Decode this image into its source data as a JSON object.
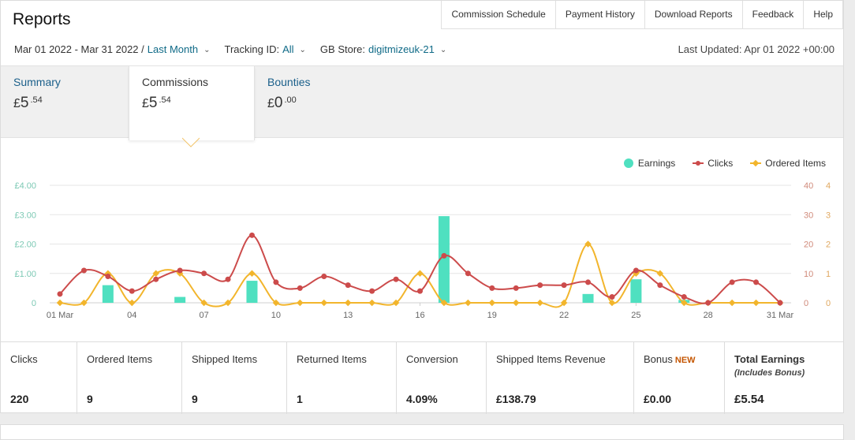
{
  "header": {
    "title": "Reports",
    "nav": [
      "Commission Schedule",
      "Payment History",
      "Download Reports",
      "Feedback",
      "Help"
    ]
  },
  "filters": {
    "date_range": "Mar 01 2022 - Mar 31 2022 /",
    "period": "Last Month",
    "tracking_label": "Tracking ID:",
    "tracking_value": "All",
    "store_label": "GB Store:",
    "store_value": "digitmizeuk-21",
    "last_updated": "Last Updated: Apr 01 2022 +00:00"
  },
  "tabs": [
    {
      "label": "Summary",
      "currency": "£",
      "whole": "5",
      "fraction": ".54"
    },
    {
      "label": "Commissions",
      "currency": "£",
      "whole": "5",
      "fraction": ".54"
    },
    {
      "label": "Bounties",
      "currency": "£",
      "whole": "0",
      "fraction": ".00"
    }
  ],
  "legend": {
    "earnings": "Earnings",
    "clicks": "Clicks",
    "ordered": "Ordered Items"
  },
  "colors": {
    "earnings": "#4fe0c0",
    "clicks": "#cc4b4b",
    "ordered": "#f2b52c",
    "link": "#0f6a87",
    "new_badge": "#c45500"
  },
  "chart_data": {
    "type": "line",
    "x": [
      1,
      2,
      3,
      4,
      5,
      6,
      7,
      8,
      9,
      10,
      11,
      12,
      13,
      14,
      15,
      16,
      17,
      18,
      19,
      20,
      21,
      22,
      23,
      24,
      25,
      26,
      27,
      28,
      29,
      30,
      31
    ],
    "xticks": [
      {
        "day": 1,
        "label": "01 Mar"
      },
      {
        "day": 4,
        "label": "04"
      },
      {
        "day": 7,
        "label": "07"
      },
      {
        "day": 10,
        "label": "10"
      },
      {
        "day": 13,
        "label": "13"
      },
      {
        "day": 16,
        "label": "16"
      },
      {
        "day": 19,
        "label": "19"
      },
      {
        "day": 22,
        "label": "22"
      },
      {
        "day": 25,
        "label": "25"
      },
      {
        "day": 28,
        "label": "28"
      },
      {
        "day": 31,
        "label": "31 Mar"
      }
    ],
    "yleft": {
      "ticks": [
        "0",
        "£1.00",
        "£2.00",
        "£3.00",
        "£4.00"
      ],
      "ylim": [
        0,
        4
      ]
    },
    "yright_clicks": {
      "ticks": [
        "0",
        "10",
        "20",
        "30",
        "40"
      ],
      "ylim": [
        0,
        40
      ]
    },
    "yright_ordered": {
      "ticks": [
        "0",
        "1",
        "2",
        "3",
        "4"
      ],
      "ylim": [
        0,
        4
      ]
    },
    "series": [
      {
        "name": "Earnings",
        "type": "bar",
        "axis": "left",
        "values": [
          0,
          0,
          0.6,
          0,
          0,
          0.2,
          0,
          0,
          0.75,
          0,
          0,
          0,
          0,
          0,
          0,
          0,
          2.95,
          0,
          0,
          0,
          0,
          0,
          0.3,
          0,
          0.8,
          0,
          0.1,
          0,
          0,
          0,
          0
        ]
      },
      {
        "name": "Clicks",
        "type": "line",
        "axis": "clicks",
        "values": [
          3,
          11,
          9,
          4,
          8,
          11,
          10,
          8,
          23,
          7,
          5,
          9,
          6,
          4,
          8,
          4,
          16,
          10,
          5,
          5,
          6,
          6,
          7,
          2,
          11,
          6,
          2,
          0,
          7,
          7,
          0
        ]
      },
      {
        "name": "Ordered Items",
        "type": "line",
        "axis": "ordered",
        "values": [
          0,
          0,
          1,
          0,
          1,
          1,
          0,
          0,
          1,
          0,
          0,
          0,
          0,
          0,
          0,
          1,
          0,
          0,
          0,
          0,
          0,
          0,
          2,
          0,
          1,
          1,
          0,
          0,
          0,
          0,
          0
        ]
      }
    ]
  },
  "stats": [
    {
      "label": "Clicks",
      "value": "220"
    },
    {
      "label": "Ordered Items",
      "value": "9"
    },
    {
      "label": "Shipped Items",
      "value": "9"
    },
    {
      "label": "Returned Items",
      "value": "1"
    },
    {
      "label": "Conversion",
      "value": "4.09%"
    },
    {
      "label": "Shipped Items Revenue",
      "value": "£138.79"
    },
    {
      "label": "Bonus",
      "badge": "NEW",
      "value": "£0.00"
    },
    {
      "label": "Total Earnings",
      "sub": "(Includes Bonus)",
      "value": "£5.54"
    }
  ]
}
